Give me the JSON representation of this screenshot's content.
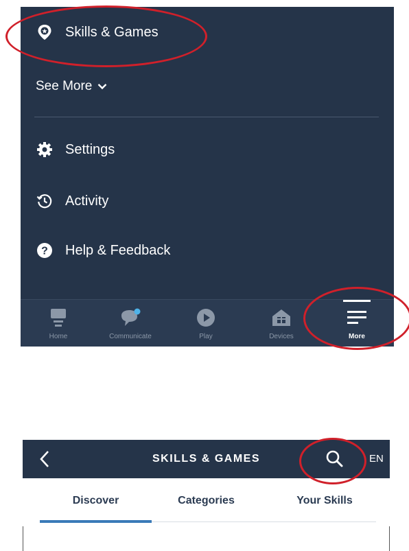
{
  "menu": {
    "skills_games": "Skills & Games",
    "see_more": "See More",
    "settings": "Settings",
    "activity": "Activity",
    "help_feedback": "Help & Feedback"
  },
  "bottom_nav": {
    "items": [
      {
        "label": "Home",
        "icon": "home-icon"
      },
      {
        "label": "Communicate",
        "icon": "chat-bubble-icon"
      },
      {
        "label": "Play",
        "icon": "play-icon"
      },
      {
        "label": "Devices",
        "icon": "devices-icon"
      },
      {
        "label": "More",
        "icon": "hamburger-menu-icon",
        "active": true
      }
    ]
  },
  "skills_page": {
    "title": "SKILLS & GAMES",
    "lang": "EN",
    "tabs": [
      {
        "label": "Discover",
        "active": true
      },
      {
        "label": "Categories"
      },
      {
        "label": "Your Skills"
      }
    ]
  },
  "colors": {
    "panel_bg": "#253449",
    "annotation": "#d0202a",
    "active_tab_underline": "#3a7ab8",
    "notification_dot": "#4fb3e8"
  }
}
